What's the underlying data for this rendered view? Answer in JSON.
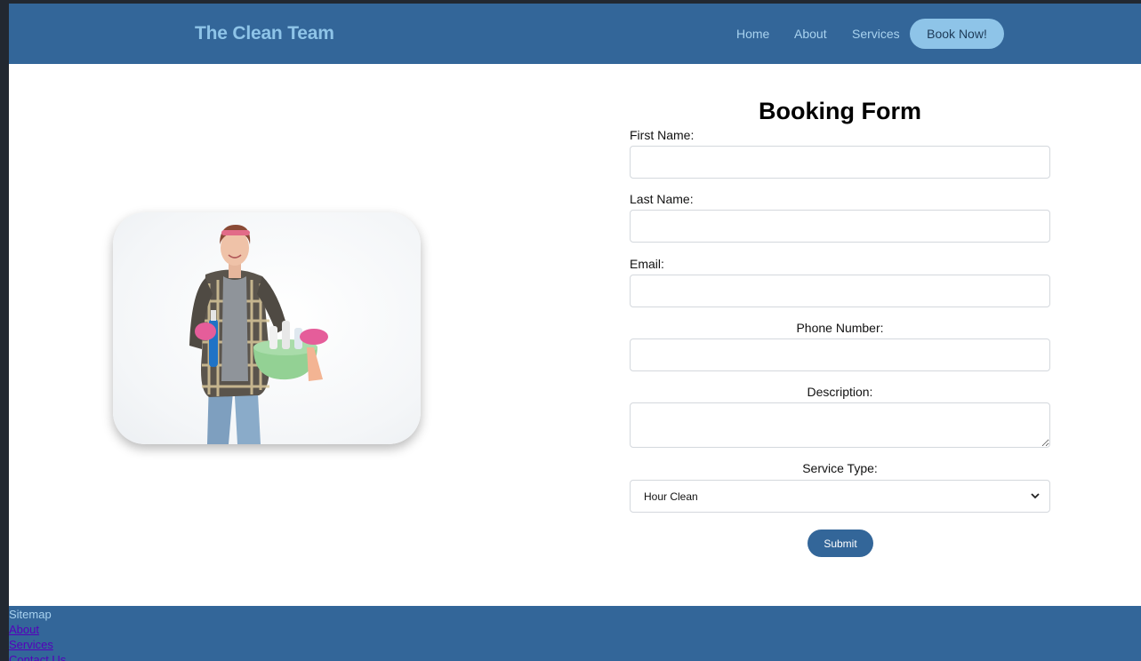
{
  "header": {
    "brand": "The Clean Team",
    "nav": [
      {
        "label": "Home"
      },
      {
        "label": "About"
      },
      {
        "label": "Services"
      }
    ],
    "cta_label": "Book Now!"
  },
  "hero": {
    "image": "woman-cleaner-holding-supplies-basket"
  },
  "form": {
    "title": "Booking Form",
    "first_name_label": "First Name:",
    "last_name_label": "Last Name:",
    "email_label": "Email:",
    "phone_label": "Phone Number:",
    "description_label": "Description:",
    "service_type_label": "Service Type:",
    "service_type_value": "Hour Clean",
    "submit_label": "Submit"
  },
  "footer": {
    "heading": "Sitemap",
    "links": [
      {
        "label": "About"
      },
      {
        "label": "Services"
      },
      {
        "label": "Contact Us"
      }
    ]
  },
  "colors": {
    "header_bg": "#336699",
    "brand": "#8ec4e8",
    "cta_bg": "#8ec4e8",
    "submit_bg": "#336699",
    "page_bg": "#ffffff",
    "outer_bg": "#222831"
  },
  "icons": {
    "select": "chevron-down-icon",
    "textarea": "resize-grip-icon"
  }
}
